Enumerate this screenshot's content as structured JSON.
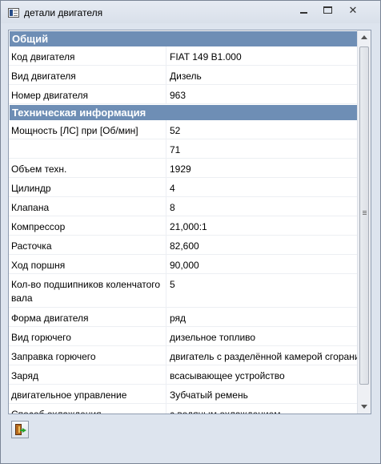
{
  "window": {
    "title": "детали двигателя"
  },
  "sections": [
    {
      "title": "Общий",
      "rows": [
        {
          "label": "Код двигателя",
          "value": "FIAT 149 B1.000"
        },
        {
          "label": "Вид двигателя",
          "value": "Дизель"
        },
        {
          "label": "Номер двигателя",
          "value": "963"
        }
      ]
    },
    {
      "title": "Техническая информация",
      "rows": [
        {
          "label": "Мощность [ЛС] при [Об/мин]",
          "value": "52",
          "value2": "71"
        },
        {
          "label": "Объем техн.",
          "value": "1929"
        },
        {
          "label": "Цилиндр",
          "value": "4"
        },
        {
          "label": "Клапана",
          "value": "8"
        },
        {
          "label": "Компрессор",
          "value": "21,000:1"
        },
        {
          "label": "Расточка",
          "value": "82,600"
        },
        {
          "label": "Ход поршня",
          "value": "90,000"
        },
        {
          "label": "Кол-во подшипников коленчатого вала",
          "value": "5"
        },
        {
          "label": "Форма двигателя",
          "value": "ряд"
        },
        {
          "label": "Вид горючего",
          "value": "дизельное топливо"
        },
        {
          "label": "Заправка горючего",
          "value": "двигатель с разделённой камерой сгорания"
        },
        {
          "label": "Заряд",
          "value": "всасывающее устройство"
        },
        {
          "label": "двигательное управление",
          "value": "Зубчатый ремень"
        },
        {
          "label": "Способ охлаждения",
          "value": "с водяным охлаждением"
        }
      ]
    }
  ],
  "toolbar": {
    "exit_icon": "exit-door-icon"
  },
  "colors": {
    "section_header": "#6e8eb5",
    "window_frame": "#dde4ee"
  }
}
